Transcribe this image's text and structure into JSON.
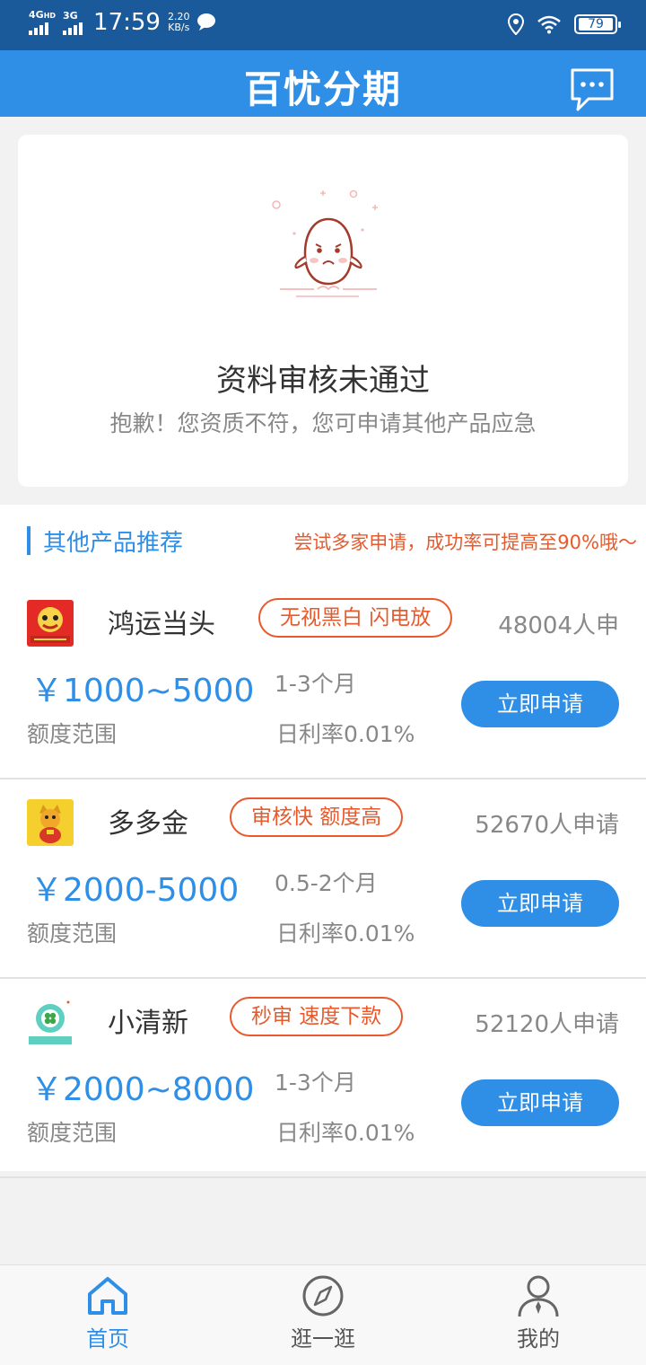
{
  "status_bar": {
    "network_1": "4G",
    "network_1_sup": "HD",
    "network_2": "3G",
    "time": "17:59",
    "speed_value": "2.20",
    "speed_unit": "KB/s",
    "battery": "79"
  },
  "header": {
    "title": "百忧分期",
    "message_icon": "chat-bubble-icon"
  },
  "result": {
    "title": "资料审核未通过",
    "subtitle": "抱歉！您资质不符，您可申请其他产品应急"
  },
  "recommend": {
    "title": "其他产品推荐",
    "tip": "尝试多家申请，成功率可提高至90%哦～"
  },
  "products": [
    {
      "name": "鸿运当头",
      "tag": "无视黑白 闪电放",
      "count": "48004人申",
      "amount": "￥1000~5000",
      "amount_label": "额度范围",
      "term": "1-3个月",
      "rate": "日利率0.01%",
      "button": "立即申请"
    },
    {
      "name": "多多金",
      "tag": "审核快 额度高",
      "count": "52670人申请",
      "amount": "￥2000-5000",
      "amount_label": "额度范围",
      "term": "0.5-2个月",
      "rate": "日利率0.01%",
      "button": "立即申请"
    },
    {
      "name": "小清新",
      "tag": "秒审 速度下款",
      "count": "52120人申请",
      "amount": "￥2000~8000",
      "amount_label": "额度范围",
      "term": "1-3个月",
      "rate": "日利率0.01%",
      "button": "立即申请"
    }
  ],
  "tabbar": {
    "items": [
      {
        "label": "首页",
        "icon": "home-icon",
        "active": true
      },
      {
        "label": "逛一逛",
        "icon": "compass-icon",
        "active": false
      },
      {
        "label": "我的",
        "icon": "user-icon",
        "active": false
      }
    ]
  },
  "colors": {
    "primary": "#2f8fe6",
    "status_bar": "#1a5a9a",
    "accent": "#e8592b"
  }
}
